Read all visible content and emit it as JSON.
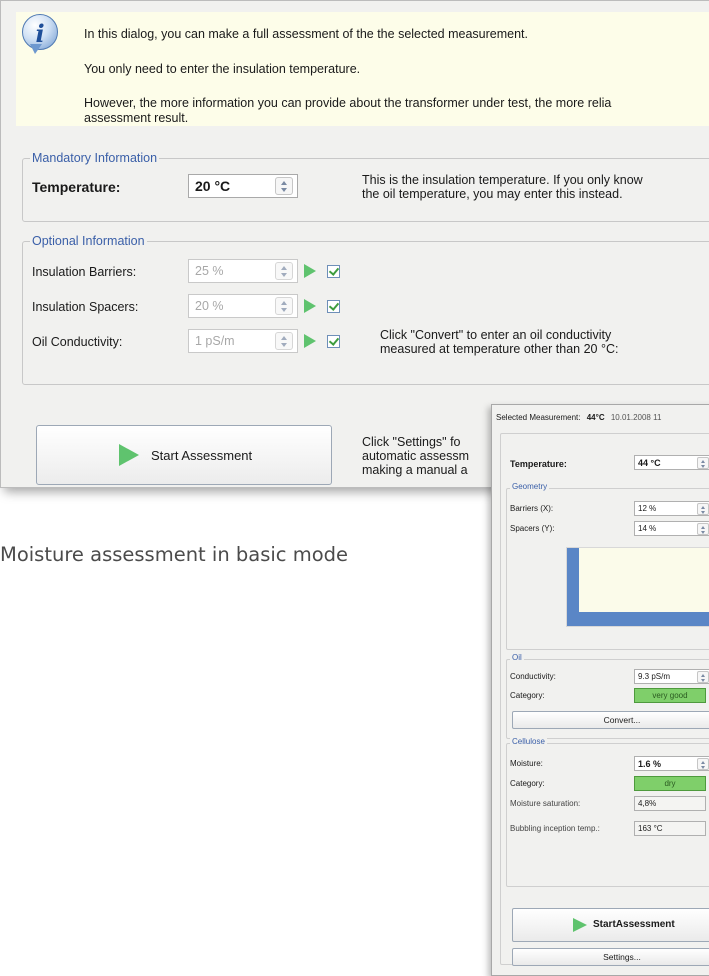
{
  "dialog": {
    "info": {
      "icon": "info-icon",
      "line1": "In this dialog, you can make a full assessment of the the selected measurement.",
      "line2": "You only need to enter the insulation temperature.",
      "line3a": "However, the more information you can provide about the transformer under test, the more relia",
      "line3b": "assessment result."
    },
    "mandatory": {
      "title": "Mandatory Information",
      "temperature_label": "Temperature:",
      "temperature_value": "20 °C",
      "hint_line1": "This is the insulation temperature. If you only know",
      "hint_line2": "the oil temperature, you may enter this instead."
    },
    "optional": {
      "title": "Optional Information",
      "rows": [
        {
          "label": "Insulation Barriers:",
          "value": "25 %",
          "checked": true
        },
        {
          "label": "Insulation Spacers:",
          "value": "20 %",
          "checked": true
        },
        {
          "label": "Oil Conductivity:",
          "value": "1 pS/m",
          "checked": true
        }
      ],
      "convert_hint_line1": "Click \"Convert\" to enter an oil conductivity",
      "convert_hint_line2": "measured at temperature other than 20 °C:"
    },
    "start_button": "Start Assessment",
    "settings_hint_line1": "Click \"Settings\" fo",
    "settings_hint_line2": "automatic assessm",
    "settings_hint_line3": "making a manual a"
  },
  "caption": "Moisture assessment in basic mode",
  "panel": {
    "header_label": "Selected Measurement:",
    "header_temp": "44°C",
    "header_date": "10.01.2008 11",
    "temperature_label": "Temperature:",
    "temperature_value": "44 °C",
    "geometry": {
      "title": "Geometry",
      "barriers_label": "Barriers (X):",
      "barriers_value": "12 %",
      "spacers_label": "Spacers (Y):",
      "spacers_value": "14 %"
    },
    "oil": {
      "title": "Oil",
      "conductivity_label": "Conductivity:",
      "conductivity_value": "9.3 pS/m",
      "category_label": "Category:",
      "category_value": "very good",
      "convert_button": "Convert..."
    },
    "cellulose": {
      "title": "Cellulose",
      "moisture_label": "Moisture:",
      "moisture_value": "1.6 %",
      "category_label": "Category:",
      "category_value": "dry",
      "saturation_label": "Moisture saturation:",
      "saturation_value": "4,8%",
      "bubbling_label": "Bubbling inception temp.:",
      "bubbling_value": "163 °C"
    },
    "start_button": "StartAssessment",
    "settings_button": "Settings..."
  },
  "colors": {
    "accent_title": "#3a5fa8",
    "info_background": "#fdfde9",
    "play_green": "#5fc36e",
    "category_green": "#7fcf6a"
  }
}
